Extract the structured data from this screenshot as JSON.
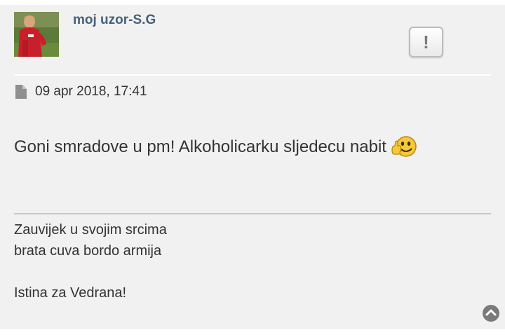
{
  "post": {
    "username": "moj uzor-S.G",
    "avatar_icon": "user-avatar",
    "report_button": {
      "icon": "exclamation-icon",
      "label": "!"
    },
    "meta": {
      "icon": "file-icon",
      "date": "09 apr 2018, 17:41"
    },
    "content": {
      "text": "Goni smradove u pm! Alkoholicarku sljedecu nabit",
      "emoji": "thumbs-up-smiley"
    },
    "signature": {
      "lines": [
        "Zauvijek u svojim srcima",
        "brata cuva bordo armija",
        "",
        "Istina za Vedrana!"
      ]
    },
    "back_to_top": {
      "icon": "chevron-up-circle-icon"
    }
  },
  "colors": {
    "username": "#46607a",
    "panel_background": "#f1f1f1",
    "text": "#333333",
    "divider": "#c9c9c9"
  }
}
